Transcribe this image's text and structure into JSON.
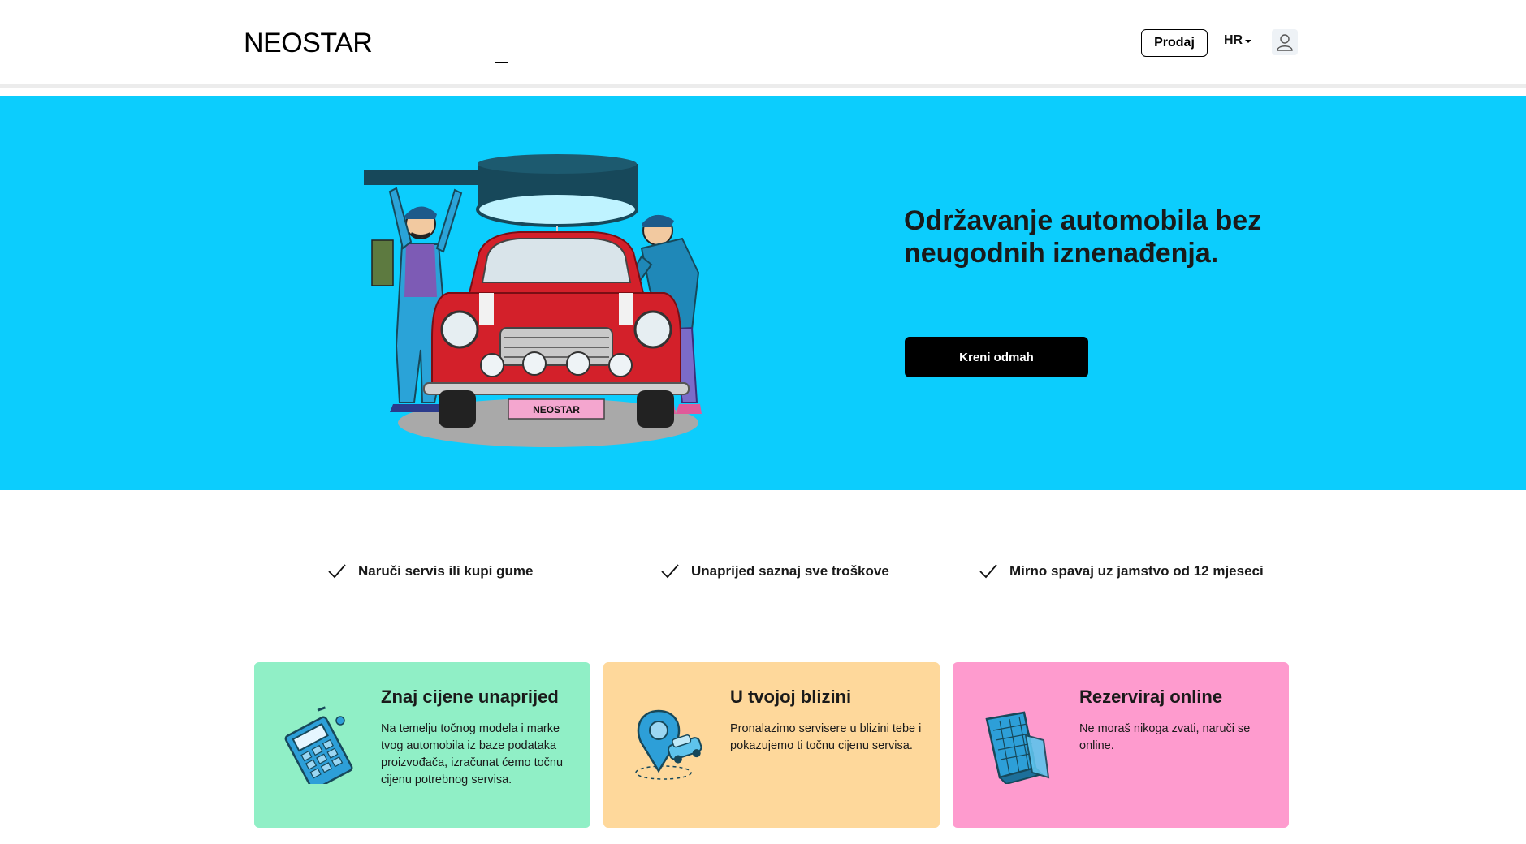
{
  "header": {
    "logo": "NEOSTAR",
    "sell_label": "Prodaj",
    "language": "HR"
  },
  "hero": {
    "title": "Održavanje automobila bez neugodnih iznenađenja.",
    "cta_label": "Kreni odmah",
    "plate_text": "NEOSTAR",
    "background": "#0ccdfd"
  },
  "features": [
    {
      "label": "Naruči servis ili kupi gume"
    },
    {
      "label": "Unaprijed saznaj sve troškove"
    },
    {
      "label": "Mirno spavaj uz jamstvo od 12 mjeseci"
    }
  ],
  "cards": [
    {
      "title": "Znaj cijene unaprijed",
      "description": "Na temelju točnog modela i marke tvog automobila iz baze podataka proizvođača, izračunat ćemo točnu cijenu potrebnog servisa.",
      "color": "#90efc6",
      "icon": "calculator-icon"
    },
    {
      "title": "U tvojoj blizini",
      "description": "Pronalazimo servisere u blizini tebe i pokazujemo ti točnu cijenu servisa.",
      "color": "#fed89b",
      "icon": "location-pin-car-icon"
    },
    {
      "title": "Rezerviraj online",
      "description": "Ne moraš nikoga zvati, naruči se online.",
      "color": "#fe9bce",
      "icon": "calendar-icon"
    }
  ]
}
